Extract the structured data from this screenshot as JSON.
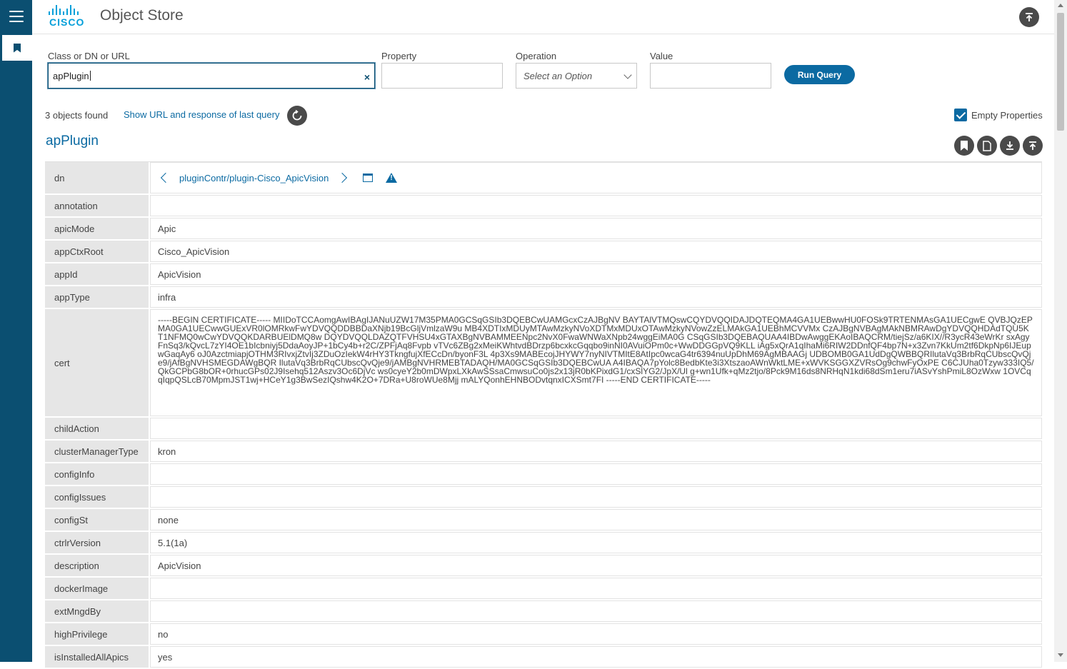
{
  "header": {
    "logo_text": "CISCO",
    "title": "Object Store"
  },
  "query": {
    "class_label": "Class or DN or URL",
    "class_value": "apPlugin",
    "property_label": "Property",
    "property_value": "",
    "operation_label": "Operation",
    "operation_placeholder": "Select an Option",
    "value_label": "Value",
    "value_value": "",
    "run_button": "Run Query",
    "clear_glyph": "×"
  },
  "results": {
    "count_text": "3 objects found",
    "show_url_text": "Show URL and response of last query",
    "empty_properties_label": "Empty Properties",
    "empty_properties_checked": true
  },
  "object": {
    "title": "apPlugin",
    "dn_link": "pluginContr/plugin-Cisco_ApicVision",
    "properties": [
      {
        "key": "dn",
        "value": ""
      },
      {
        "key": "annotation",
        "value": ""
      },
      {
        "key": "apicMode",
        "value": "Apic"
      },
      {
        "key": "appCtxRoot",
        "value": "Cisco_ApicVision"
      },
      {
        "key": "appId",
        "value": "ApicVision"
      },
      {
        "key": "appType",
        "value": "infra"
      },
      {
        "key": "cert",
        "value": "-----BEGIN CERTIFICATE----- MIIDoTCCAomgAwIBAgIJANuUZW17M35PMA0GCSqGSIb3DQEBCwUAMGcxCzAJBgNV BAYTAlVTMQswCQYDVQQIDAJDQTEQMA4GA1UEBwwHU0FOSk9TRTENMAsGA1UECgwE QVBJQzEPMA0GA1UECwwGUExVR0lOMRkwFwYDVQQDDBBDaXNjb19BcGljVmlzaW9u MB4XDTIxMDUyMTAwMzkyNVoXDTMxMDUxOTAwMzkyNVowZzELMAkGA1UEBhMCVVMx CzAJBgNVBAgMAkNBMRAwDgYDVQQHDAdTQU5KT1NFMQ0wCwYDVQQKDARBUElDMQ8w DQYDVQQLDAZQTFVHSU4xGTAXBgNVBAMMEENpc2NvX0FwaWNWaXNpb24wggEiMA0G CSqGSIb3DQEBAQUAA4IBDwAwggEKAoIBAQCRM/tiejSz/a6KIX//R3ycR43eWrKr sxAgyFnSq3/kQvcL7zYI4OE1bIcbniyj5DdaAoyJP+1bCy4b+r2C/ZPFjAq8Fvpb vTVc6ZBg2xMeiKWhtvdBDrzp6bcxkcGqqbo9inNI0AVuiOPm0c+WwDDGGpVQ9KLL iAg5xQrA1qIhaMi6RIW2DDnfQF4bp7N+x3Zvn7KkUm2tf6DkpNp6IJEupwGaqAy6 oJ0AzctmiapjOTHM3RIvxjZtvIj3ZDuOzIekW4rHY3TkngfujXfECcDn/byonF3L 4p3Xs9MABEcojJHYWY7nyNIVTMItE8AtIpc0wcaG4tr6394nuUpDhM69AgMBAAGj UDBOMB0GA1UdDgQWBBQRIlutaVq3BrbRqCUbscQvQje9/jAfBgNVHSMEGDAWgBQR IlutaVq3BrbRqCUbscQvQje9/jAMBgNVHRMEBTADAQH/MA0GCSqGSIb3DQEBCwUA A4IBAQA7pYolc8BedbKte3i3XtszaoAWnWktLME+xWVKSGGXZVRsOg9chwFyOxPE C6CJUha0Tzyw333IQ5/QkGCPbG8bOR+0rhucGPs02J9Isehq512Aszv3Oc6DjVc ws0cyeY2b0mDWpxLXkAwSSsaCmwsuCo0js2x13jR0bKPixdG1/cxSlYG2/JpX/Ul g+wn1Ufk+qMz2tjo/8Pck9M16ds8NRHqN1kdi68dSm1eru7iASvYshPmiL8OzWxw 1OVCqqIqpQSLcB70MpmJST1wj+HCeY1g3BwSezIQshw4K2O+7DRa+U8roWUe8Mjj mALYQonhEHNBODvtqnxICXSmt7FI -----END CERTIFICATE-----"
      },
      {
        "key": "childAction",
        "value": ""
      },
      {
        "key": "clusterManagerType",
        "value": "kron"
      },
      {
        "key": "configInfo",
        "value": ""
      },
      {
        "key": "configIssues",
        "value": ""
      },
      {
        "key": "configSt",
        "value": "none"
      },
      {
        "key": "ctrlrVersion",
        "value": "5.1(1a)"
      },
      {
        "key": "description",
        "value": "ApicVision"
      },
      {
        "key": "dockerImage",
        "value": ""
      },
      {
        "key": "extMngdBy",
        "value": ""
      },
      {
        "key": "highPrivilege",
        "value": "no"
      },
      {
        "key": "isInstalledAllApics",
        "value": "yes"
      }
    ]
  }
}
